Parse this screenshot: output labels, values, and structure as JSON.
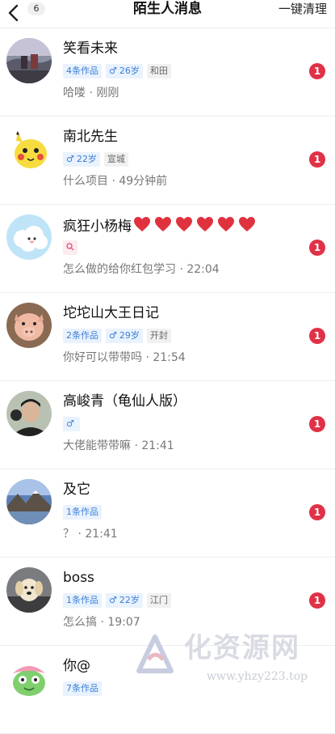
{
  "header": {
    "back_count": "6",
    "title": "陌生人消息",
    "clear_label": "一键清理"
  },
  "colors": {
    "tag_blue_bg": "#e9f2fd",
    "tag_blue_text": "#3b7fd6",
    "tag_gray_bg": "#f1f1f1",
    "unread_badge": "#e03147",
    "heart": "#e0323e"
  },
  "messages": [
    {
      "name": "笑看未来",
      "works_tag": "4条作品",
      "gender_symbol": "♂",
      "age": "26岁",
      "location": "和田",
      "preview": "哈喽 · 刚刚",
      "unread": "1",
      "avatar_icon": "landscape-photo"
    },
    {
      "name": "南北先生",
      "gender_symbol": "♂",
      "age": "22岁",
      "location": "宣城",
      "preview": "什么项目 · 49分钟前",
      "unread": "1",
      "avatar_icon": "pikachu-cartoon"
    },
    {
      "name": "疯狂小杨梅",
      "hearts_count": 6,
      "pink_tag_icon": "search-icon",
      "preview": "怎么做的给你红包学习 · 22:04",
      "unread": "1",
      "avatar_icon": "cloud-sheep-cartoon"
    },
    {
      "name": "坨坨山大王日记",
      "works_tag": "2条作品",
      "gender_symbol": "♂",
      "age": "29岁",
      "location": "开封",
      "preview": "你好可以带带吗 · 21:54",
      "unread": "1",
      "avatar_icon": "pig-photo"
    },
    {
      "name": "高峻青（龟仙人版）",
      "gender_symbol": "♂",
      "preview": "大佬能带带嘛 · 21:41",
      "unread": "1",
      "avatar_icon": "person-photo"
    },
    {
      "name": "及它",
      "works_tag": "1条作品",
      "preview": "？ · 21:41",
      "unread": "1",
      "avatar_icon": "mountain-photo"
    },
    {
      "name": "boss",
      "works_tag": "1条作品",
      "gender_symbol": "♂",
      "age": "22岁",
      "location": "江门",
      "preview": "怎么搞 · 19:07",
      "unread": "1",
      "avatar_icon": "dog-photo"
    },
    {
      "name": "你@",
      "works_tag": "7条作品",
      "avatar_icon": "frog-cartoon"
    }
  ],
  "watermark": {
    "text": "化资源网",
    "url": "www.yhzy223.top"
  }
}
